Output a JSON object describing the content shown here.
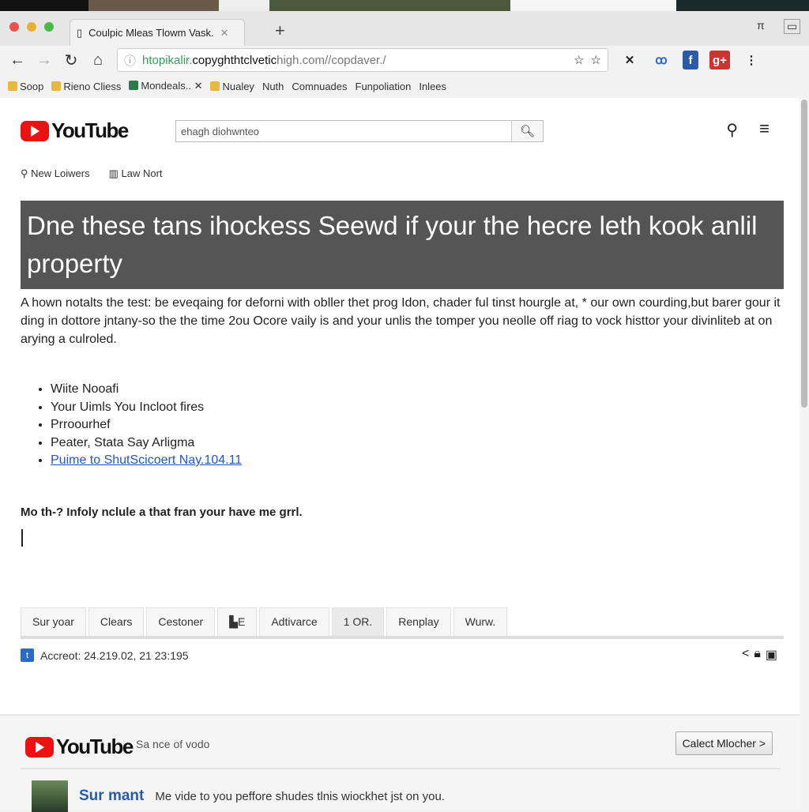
{
  "browser": {
    "tab_title": "Coulpic Mleas Tlowm Vask.",
    "url_green": "htopikalir.",
    "url_bold": "copyghthtclvetic",
    "url_rest": "high.com//copdaver./",
    "bookmarks": [
      "Soop",
      "Rieno Cliess",
      "Mondeals..",
      "Nualey",
      "Nuth",
      "Comnuades",
      "Funpoliation",
      "Inlees"
    ]
  },
  "header": {
    "logo": "YouTube",
    "search_value": "ehagh diohwnteo"
  },
  "subnav": [
    "New Loiwers",
    "Law Nort"
  ],
  "banner": {
    "title": "Dne these tans ihockess Seewd if your the hecre leth kook anlil property"
  },
  "paragraph": "A hown notalts the test: be eveqaing for deforni with obller thet prog Idon, chader ful tinst hourgle at, * our own courding,but barer gour it ding in dottore jntany-so the the time 2ou Ocore vaily is and your unlis the tomper you neolle off riag to vock histtor your divinliteb at on arying a culroled.",
  "list": [
    "Wiite Nooafi",
    "Your Uimls You Incloot fires",
    "Prroourhef",
    "Peater, Stata Say Arligma"
  ],
  "list_link": "Puime to ShutScicoert Nay.104.11",
  "bold_line": "Mo th-? Infoly nclule a that fran your have me grrl.",
  "tabs": [
    "Sur yoar",
    "Clears",
    "Cestoner",
    "E",
    "Adtivarce",
    "1 OR.",
    "Renplay",
    "Wurw."
  ],
  "active_tab": 5,
  "account_line": "Accreot: 24.219.02, 21 23:195",
  "footer": {
    "logo": "YouTube",
    "subtitle": "Sa nce of vodo",
    "button": "Calect Mlocher >"
  },
  "comment": {
    "name": "Sur mant",
    "text": "Me vide to you peffore shudes tlnis wiockhet jst on you."
  },
  "colors": {
    "youtube_red": "#e11111",
    "banner_bg": "#555555",
    "link": "#2255cc"
  }
}
